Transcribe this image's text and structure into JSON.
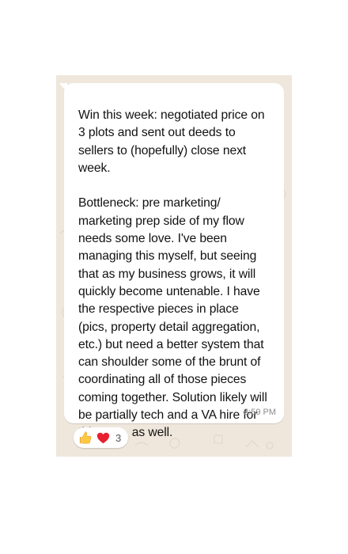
{
  "message": {
    "text": "Win this week: negotiated price on\n3 plots and sent out deeds to\nsellers to (hopefully) close next\nweek.\n\nBottleneck: pre marketing/\nmarketing prep side of my flow\nneeds some love. I've been\nmanaging this myself, but seeing\nthat as my business grows, it will\nquickly become untenable. I have\nthe respective pieces in place\n(pics, property detail aggregation,\netc.) but need a better system that\ncan shoulder some of the brunt of\ncoordinating all of those pieces\ncoming together. Solution likely will\nbe partially tech and a VA hire for\nthis area, as well.",
    "time": "8:59 PM"
  },
  "reactions": {
    "emojis": [
      "thumbs-up-icon",
      "red-heart-icon"
    ],
    "count": "3"
  },
  "colors": {
    "chat_background": "#efe7dc",
    "bubble": "#ffffff",
    "timestamp": "#8c8c8c"
  }
}
